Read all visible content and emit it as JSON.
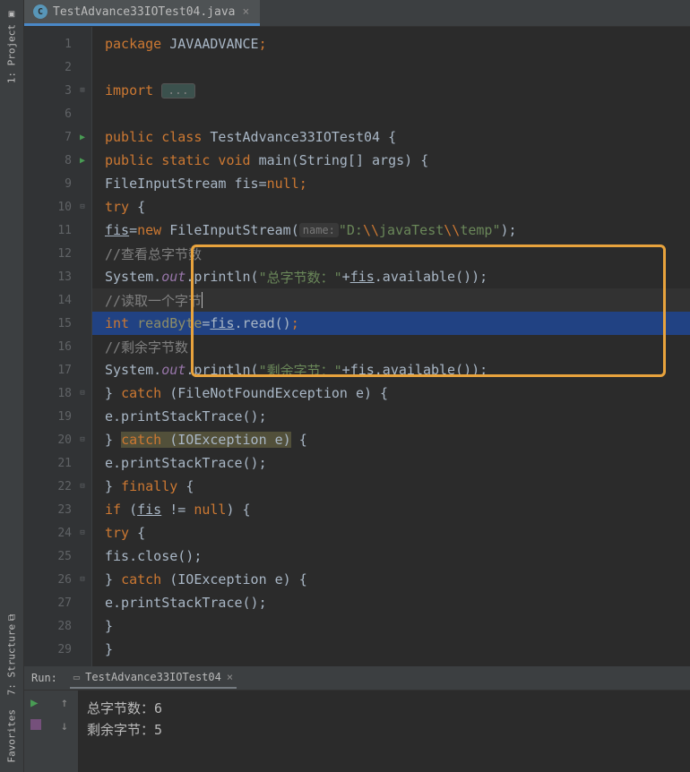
{
  "sidebar": {
    "project_label": "1: Project",
    "structure_label": "7: Structure",
    "favorites_label": "Favorites"
  },
  "tab": {
    "filename": "TestAdvance33IOTest04.java"
  },
  "code": {
    "lines": [
      {
        "n": "1"
      },
      {
        "n": "2"
      },
      {
        "n": "3"
      },
      {
        "n": "6"
      },
      {
        "n": "7"
      },
      {
        "n": "8"
      },
      {
        "n": "9"
      },
      {
        "n": "10"
      },
      {
        "n": "11"
      },
      {
        "n": "12"
      },
      {
        "n": "13"
      },
      {
        "n": "14"
      },
      {
        "n": "15"
      },
      {
        "n": "16"
      },
      {
        "n": "17"
      },
      {
        "n": "18"
      },
      {
        "n": "19"
      },
      {
        "n": "20"
      },
      {
        "n": "21"
      },
      {
        "n": "22"
      },
      {
        "n": "23"
      },
      {
        "n": "24"
      },
      {
        "n": "25"
      },
      {
        "n": "26"
      },
      {
        "n": "27"
      },
      {
        "n": "28"
      },
      {
        "n": "29"
      }
    ],
    "l1_package": "package ",
    "l1_pkg": "JAVAADVANCE",
    "l1_semi": ";",
    "l3_import": "import ",
    "l3_fold": "...",
    "l7_public": "public class ",
    "l7_cls": "TestAdvance33IOTest04 {",
    "l8_mod": "public static void ",
    "l8_main": "main",
    "l8_args": "(String[] args) {",
    "l9_txt": "FileInputStream fis=",
    "l9_null": "null",
    "l9_semi": ";",
    "l10_try": "try ",
    "l10_brace": "{",
    "l11_fis": "fis",
    "l11_eq": "=",
    "l11_new": "new ",
    "l11_ctor": "FileInputStream(",
    "l11_hint": "name:",
    "l11_str1": "\"D:",
    "l11_esc1": "\\\\",
    "l11_str2": "javaTest",
    "l11_esc2": "\\\\",
    "l11_str3": "temp\"",
    "l11_end": ");",
    "l12_c": "//查看总字节数",
    "l13_sys": "System.",
    "l13_out": "out",
    "l13_pln": ".println(",
    "l13_str": "\"总字节数：\"",
    "l13_plus": "+",
    "l13_fis": "fis",
    "l13_avail": ".available());",
    "l14_c": "//读取一个字节",
    "l15_int": "int ",
    "l15_var": "readByte",
    "l15_eq": "=",
    "l15_fis": "fis",
    "l15_read": ".read()",
    "l15_semi": ";",
    "l16_c": "//剩余字节数",
    "l17_sys": "System.",
    "l17_out": "out",
    "l17_pln": ".println(",
    "l17_str": "\"剩余字节：\"",
    "l17_plus": "+",
    "l17_fis": "fis",
    "l17_avail": ".available());",
    "l18_txt": "} ",
    "l18_catch": "catch ",
    "l18_ex": "(FileNotFoundException e) {",
    "l19_txt": "e.printStackTrace();",
    "l20_txt": "} ",
    "l20_catch": "catch ",
    "l20_ex": "(IOException e)",
    "l20_brace": " {",
    "l21_txt": "e.printStackTrace();",
    "l22_txt": "} ",
    "l22_fin": "finally ",
    "l22_brace": "{",
    "l23_if": "if ",
    "l23_cond": "(",
    "l23_fis": "fis",
    "l23_ne": " != ",
    "l23_null": "null",
    "l23_end": ") {",
    "l24_try": "try ",
    "l24_brace": "{",
    "l25_txt": "fis.close();",
    "l26_txt": "} ",
    "l26_catch": "catch ",
    "l26_ex": "(IOException e) {",
    "l27_txt": "e.printStackTrace();",
    "l28_txt": "}",
    "l29_txt": "}"
  },
  "run": {
    "label": "Run:",
    "config": "TestAdvance33IOTest04",
    "out1": "总字节数：6",
    "out2": "剩余字节：5"
  }
}
